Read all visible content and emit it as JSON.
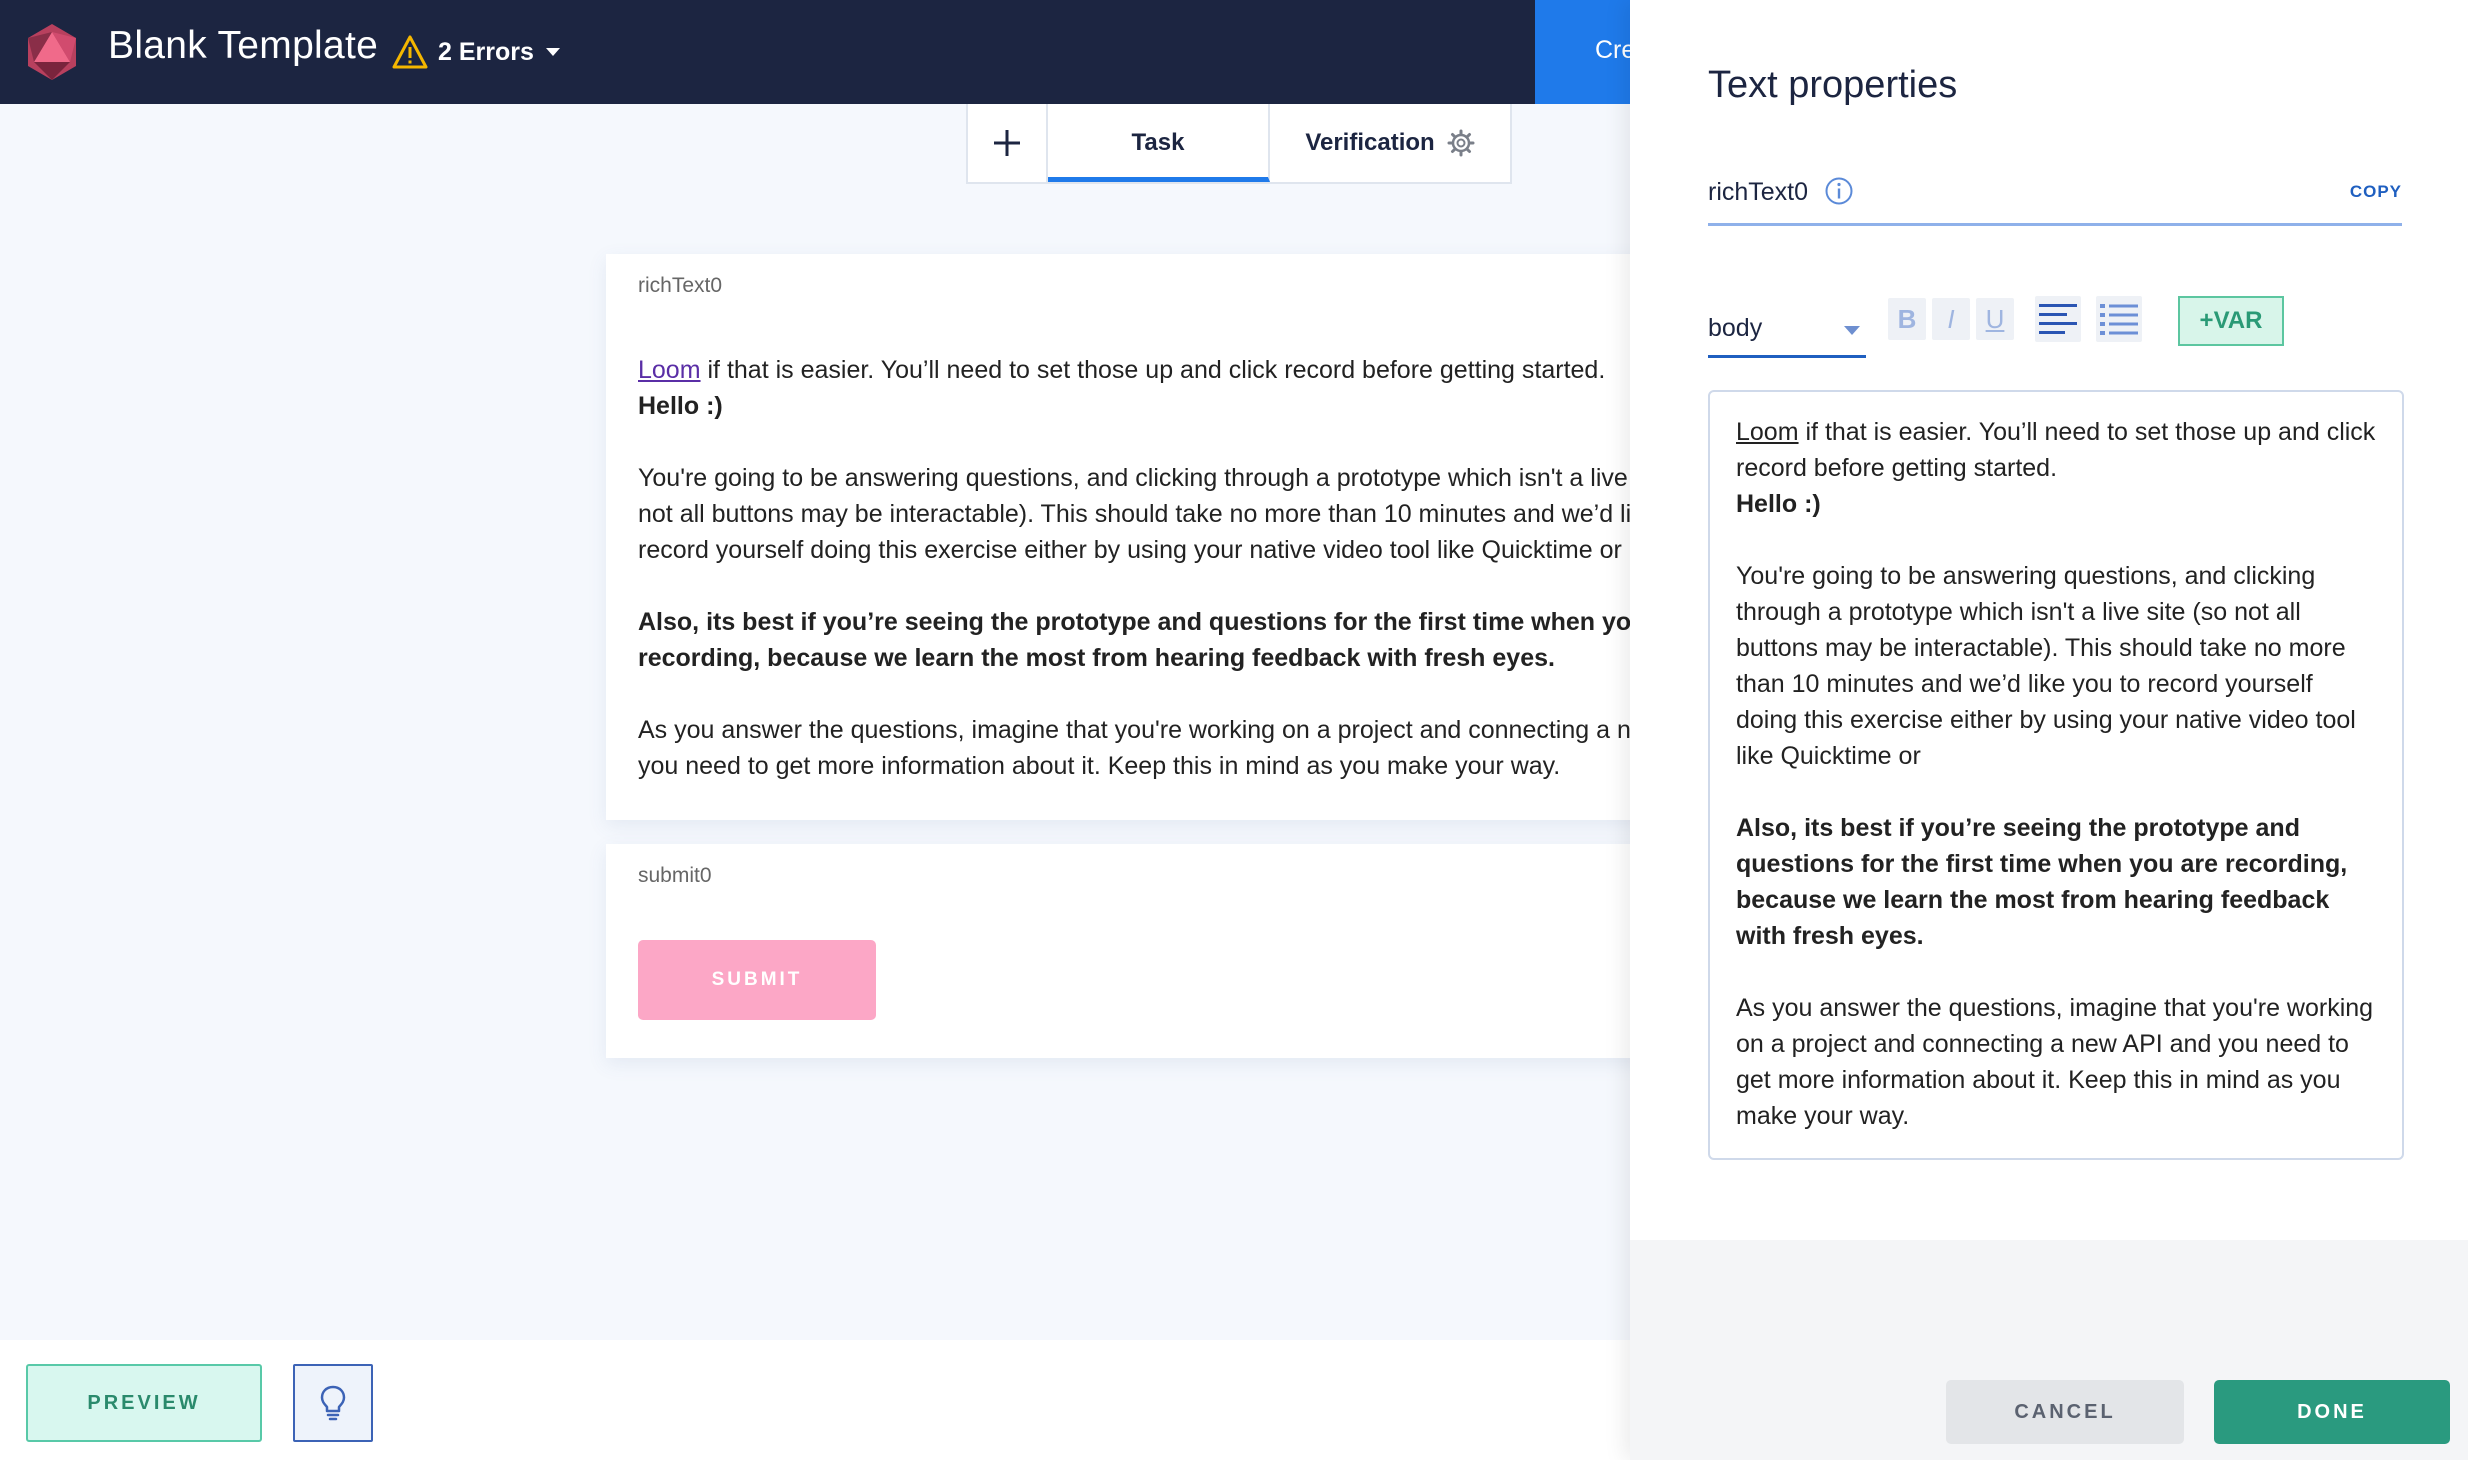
{
  "header": {
    "title": "Blank Template",
    "errors_label": "2 Errors",
    "create_label": "Cre"
  },
  "tabs": {
    "add_icon": "plus-icon",
    "task_label": "Task",
    "verification_label": "Verification"
  },
  "canvas": {
    "rich_text": {
      "label": "richText0",
      "link_text": "Loom",
      "line1_rest": " if that is easier. You’ll need to set those up and click record before getting started.",
      "line2": "Hello :)",
      "para1_line1": "You're going to be answering questions, and clicking through a prototype which isn't a live site (so",
      "para1_line2": "not all buttons may be interactable). This should take no more than 10 minutes and we’d like you to",
      "para1_line3": "record yourself doing this exercise either by using your native video tool like Quicktime or",
      "bold_line1": "Also, its best if you’re seeing the prototype and questions for the first time when you are",
      "bold_line2": "recording, because we learn the most from hearing feedback with fresh eyes.",
      "para3_line1": "As you answer the questions, imagine that you're working on a project and connecting a new API and",
      "para3_line2": "you need to get more information about it. Keep this in mind as you make your way."
    },
    "submit": {
      "label": "submit0",
      "button_label": "SUBMIT"
    }
  },
  "bottom": {
    "preview_label": "PREVIEW",
    "bulb_icon": "lightbulb-icon"
  },
  "panel": {
    "title": "Text properties",
    "name_value": "richText0",
    "copy_label": "COPY",
    "style_value": "body",
    "bold_label": "B",
    "italic_label": "I",
    "underline_label": "U",
    "var_label": "+VAR",
    "editor": {
      "link_text": "Loom",
      "line1_rest": " if that is easier. You’ll need to set those up and click record before getting started.",
      "hello": "Hello :)",
      "para1": "You're going to be answering questions, and clicking through a prototype which isn't a live site (so not all buttons may be interactable). This should take no more than 10 minutes and we’d like you to record yourself doing this exercise either by using your native video tool like Quicktime or",
      "bold": "Also, its best if you’re seeing the prototype and questions for the first time when you are recording, because we learn the most from hearing feedback with fresh eyes.",
      "para3": "As you answer the questions, imagine that you're working on a project and connecting a new API and you need to get more information about it. Keep this in mind as you make your way."
    },
    "cancel_label": "CANCEL",
    "done_label": "DONE"
  },
  "colors": {
    "topbar": "#1c2541",
    "accent_blue": "#1f7aea",
    "submit_pink": "#fca7c6",
    "done_green": "#2a9a7f",
    "warning_yellow": "#f5b700"
  }
}
